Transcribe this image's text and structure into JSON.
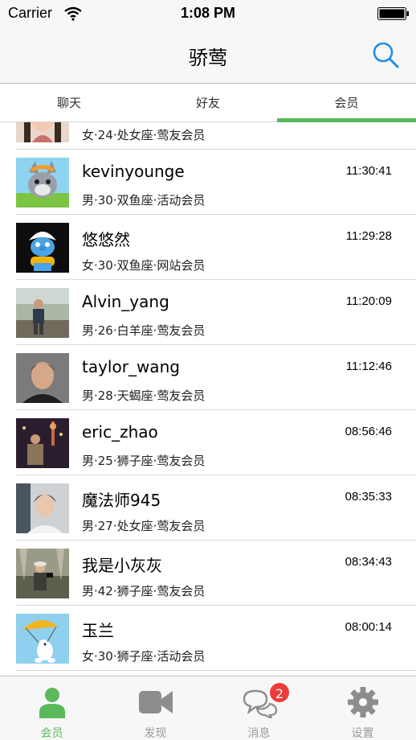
{
  "status_bar": {
    "carrier": "Carrier",
    "time": "1:08 PM"
  },
  "nav": {
    "title": "骄莺",
    "search_icon": "search-icon"
  },
  "tabs": [
    {
      "label": "聊天",
      "selected": false
    },
    {
      "label": "好友",
      "selected": false
    },
    {
      "label": "会员",
      "selected": true
    }
  ],
  "accent_color": "#5cb85c",
  "members": [
    {
      "name": "",
      "time": "",
      "meta": "女·24·处女座·莺友会员",
      "avatar": "female-photo"
    },
    {
      "name": "kevinyounge",
      "time": "11:30:41",
      "meta": "男·30·双鱼座·活动会员",
      "avatar": "cartoon-wolf"
    },
    {
      "name": "悠悠然",
      "time": "11:29:28",
      "meta": "女·30·双鱼座·网站会员",
      "avatar": "smurf"
    },
    {
      "name": "Alvin_yang",
      "time": "11:20:09",
      "meta": "男·26·白羊座·莺友会员",
      "avatar": "outdoor-photo"
    },
    {
      "name": "taylor_wang",
      "time": "11:12:46",
      "meta": "男·28·天蝎座·莺友会员",
      "avatar": "portrait-photo"
    },
    {
      "name": "eric_zhao",
      "time": "08:56:46",
      "meta": "男·25·狮子座·莺友会员",
      "avatar": "night-city-photo"
    },
    {
      "name": "魔法师945",
      "time": "08:35:33",
      "meta": "男·27·处女座·莺友会员",
      "avatar": "indoor-photo"
    },
    {
      "name": "我是小灰灰",
      "time": "08:34:43",
      "meta": "男·42·狮子座·莺友会员",
      "avatar": "photographer-photo"
    },
    {
      "name": "玉兰",
      "time": "08:00:14",
      "meta": "女·30·狮子座·活动会员",
      "avatar": "parachute-cartoon"
    }
  ],
  "tab_bar": [
    {
      "label": "会员",
      "icon": "person-icon",
      "active": true
    },
    {
      "label": "发现",
      "icon": "video-camera-icon",
      "active": false
    },
    {
      "label": "消息",
      "icon": "chat-bubbles-icon",
      "active": false,
      "badge": "2"
    },
    {
      "label": "设置",
      "icon": "gear-icon",
      "active": false
    }
  ]
}
